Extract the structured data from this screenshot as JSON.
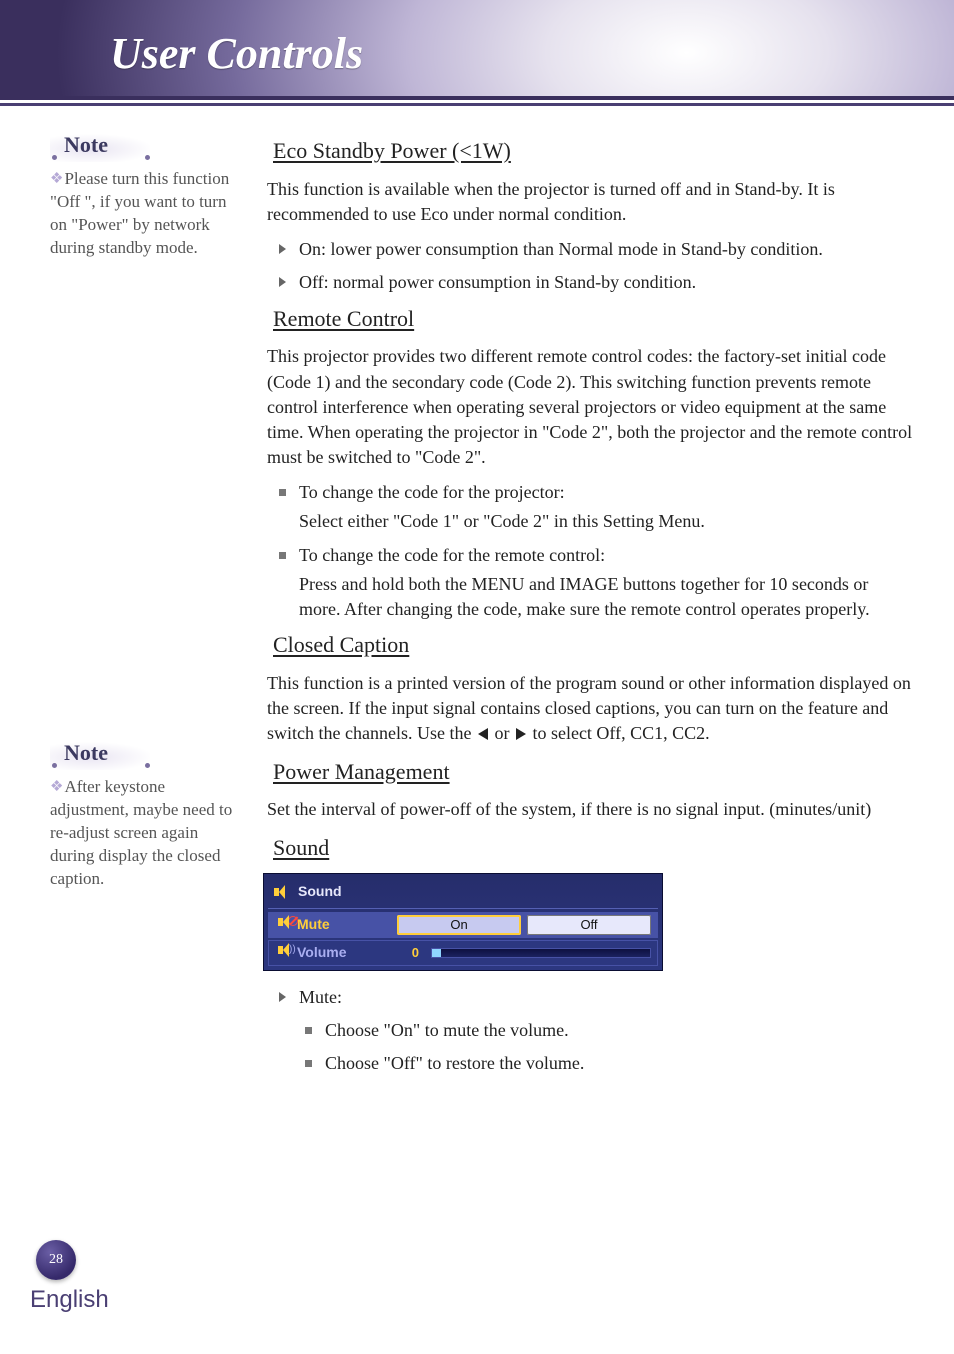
{
  "header": {
    "title": "User Controls"
  },
  "sidebar": {
    "note_label": "Note",
    "note1": "Please turn this function \"Off \", if you want to turn on \"Power\" by network during standby mode.",
    "note2": "After keystone adjustment, maybe need to re-adjust screen again during display the closed caption."
  },
  "sections": {
    "eco": {
      "title": "Eco Standby Power (<1W)",
      "desc": "This function is available when the projector is turned off and in Stand-by. It is recommended to use Eco under normal condition.",
      "on": "On: lower power consumption than Normal mode in Stand-by condition.",
      "off": "Off: normal power consumption in Stand-by condition."
    },
    "remote": {
      "title": "Remote Control",
      "desc": "This projector provides two different remote control codes: the factory-set initial code (Code 1) and the secondary code (Code 2). This switching function prevents remote control interference when operating several projectors or video equipment at the same time. When operating the projector in \"Code 2\", both the projector and the remote control must be switched to \"Code 2\".",
      "li1_head": "To change the code for the projector:",
      "li1_body": "Select either \"Code 1\" or \"Code 2\" in this Setting Menu.",
      "li2_head": "To change the code for the remote control:",
      "li2_body": "Press and hold both the MENU and IMAGE buttons together for 10 seconds or more. After changing the code, make sure the remote control operates properly."
    },
    "cc": {
      "title": "Closed Caption",
      "desc_a": "This function is a printed version of the program sound or other information displayed on the screen. If the input signal contains closed captions, you can turn on the feature and switch the channels. Use the ",
      "desc_mid": " or ",
      "desc_b": " to select Off, CC1, CC2."
    },
    "pm": {
      "title": "Power Management",
      "desc": "Set the interval of power-off of the system, if there is no signal input. (minutes/unit)"
    },
    "sound": {
      "title": "Sound",
      "panel": {
        "header": "Sound",
        "mute_label": "Mute",
        "mute_on": "On",
        "mute_off": "Off",
        "volume_label": "Volume",
        "volume_value": "0"
      },
      "mute_head": "Mute:",
      "mute_on_text": "Choose \"On\" to mute the volume.",
      "mute_off_text": "Choose \"Off\" to restore the volume."
    }
  },
  "footer": {
    "page": "28",
    "lang": "English"
  }
}
